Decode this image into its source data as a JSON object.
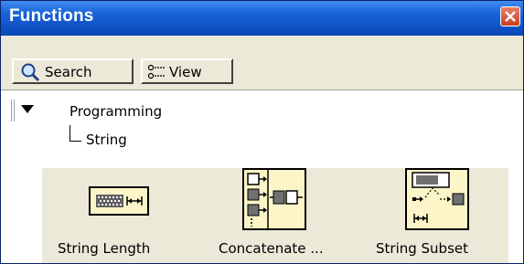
{
  "window": {
    "title": "Functions",
    "close_icon": "close-icon",
    "accent": "#0a47b4"
  },
  "toolbar": {
    "search_label": "Search",
    "search_icon": "magnifier-icon",
    "view_label": "View",
    "view_icon": "view-list-icon"
  },
  "tree": {
    "expand_icon": "triangle-down-icon",
    "root_label": "Programming",
    "child_label": "String"
  },
  "palette": {
    "items": [
      {
        "label": "String Length",
        "icon": "string-length-icon"
      },
      {
        "label": "Concatenate ...",
        "icon": "concatenate-strings-icon"
      },
      {
        "label": "String Subset",
        "icon": "string-subset-icon"
      }
    ]
  }
}
